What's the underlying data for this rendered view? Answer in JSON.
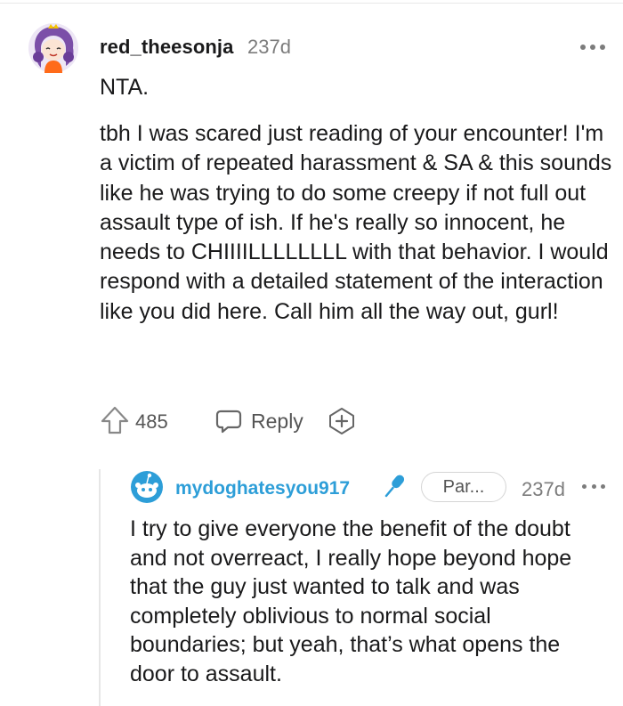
{
  "comment": {
    "username": "red_theesonja",
    "age": "237d",
    "paragraphs": [
      "NTA.",
      "tbh I was scared just reading of your encounter! I'm a victim of repeated harassment & SA & this sounds like he was trying to do some creepy if not full out assault type of ish. If he's really so innocent, he needs to CHIIIILLLLLLLL with that behavior. I would respond with a detailed statement of the interaction like you did here. Call him all the way out, gurl!"
    ],
    "votes": "485",
    "reply_label": "Reply",
    "icons": [
      "avatar",
      "more-options-icon",
      "upvote-arrow-icon",
      "reply-chat-bubble-icon",
      "award-plus-icon"
    ]
  },
  "reply": {
    "username": "mydoghatesyou917",
    "flair": "Par...",
    "age": "237d",
    "text": "I try to give everyone the benefit of the doubt and not overreact, I really hope beyond hope that the guy just wanted to talk and was completely oblivious to normal social boundaries; but yeah, that’s what opens the door to assault.",
    "icons": [
      "snoo-avatar",
      "microphone-icon",
      "more-options-icon"
    ]
  },
  "colors": {
    "reply_username": "#2d9ed8",
    "mic": "#2d9ed8",
    "muted": "#7c7c7c",
    "avatar_purple": "#7b4fa8",
    "avatar_orange": "#ff6b1a"
  }
}
